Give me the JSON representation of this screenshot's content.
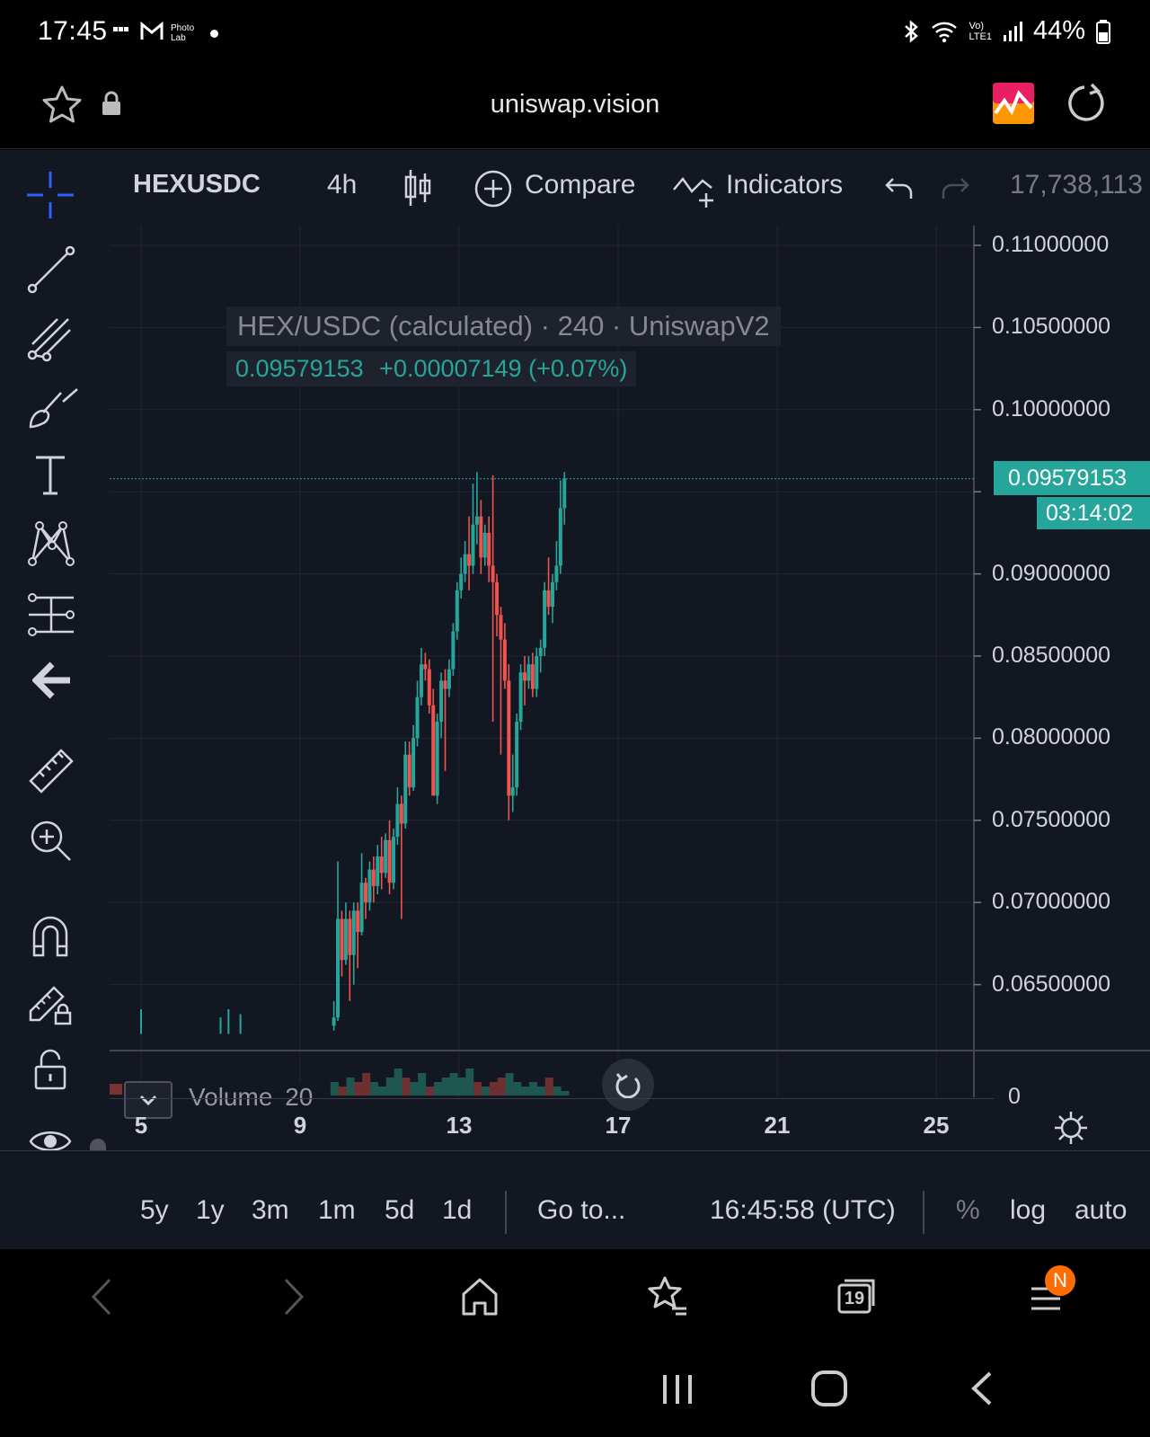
{
  "status_bar": {
    "time": "17:45",
    "battery": "44%",
    "notif_icons": [
      "bbc-news-icon",
      "gmail-icon",
      "photo-lab-icon",
      "dot-icon"
    ],
    "notif_labels": [
      "BBC NEWS",
      "Photo Lab"
    ]
  },
  "browser": {
    "url": "uniswap.vision"
  },
  "toolbar": {
    "symbol": "HEXUSDC",
    "interval": "4h",
    "compare": "Compare",
    "indicators": "Indicators",
    "volume_readout": "17,738,113"
  },
  "legend": {
    "title": "HEX/USDC (calculated) · 240 · UniswapV2",
    "last": "0.09579153",
    "change": "+0.00007149 (+0.07%)"
  },
  "price_axis": {
    "labels": [
      "0.11000000",
      "0.10500000",
      "0.10000000",
      "0.09579153",
      "0.09000000",
      "0.08500000",
      "0.08000000",
      "0.07500000",
      "0.07000000",
      "0.06500000"
    ],
    "current_price": "0.09579153",
    "countdown": "03:14:02",
    "volume_zero": "0"
  },
  "time_axis": {
    "labels": [
      "5",
      "9",
      "13",
      "17",
      "21",
      "25"
    ]
  },
  "volume_pane": {
    "label": "Volume",
    "length": "20"
  },
  "timeframes": [
    "5y",
    "1y",
    "3m",
    "1m",
    "5d",
    "1d"
  ],
  "bottom_bar": {
    "goto": "Go to...",
    "clock": "16:45:58 (UTC)",
    "percent": "%",
    "log": "log",
    "auto": "auto"
  },
  "nav": {
    "tabs_count": "19",
    "badge": "N"
  },
  "colors": {
    "up": "#26a69a",
    "down": "#ef5350",
    "background": "#131722"
  },
  "chart_data": {
    "type": "candlestick",
    "title": "HEX/USDC (calculated) · 240 · UniswapV2",
    "x_ticks": [
      "5",
      "9",
      "13",
      "17",
      "21",
      "25"
    ],
    "ylim": [
      0.062,
      0.112
    ],
    "y_ticks": [
      0.065,
      0.07,
      0.075,
      0.08,
      0.085,
      0.09,
      0.095,
      0.1,
      0.105,
      0.11
    ],
    "last_price": 0.09579153,
    "candles": [
      [
        9.85,
        0.0625,
        0.063,
        0.0622,
        0.064
      ],
      [
        9.95,
        0.063,
        0.069,
        0.0628,
        0.0725
      ],
      [
        10.05,
        0.069,
        0.0665,
        0.0655,
        0.0695
      ],
      [
        10.15,
        0.0665,
        0.069,
        0.0662,
        0.07
      ],
      [
        10.25,
        0.069,
        0.0668,
        0.064,
        0.0695
      ],
      [
        10.35,
        0.0668,
        0.0695,
        0.065,
        0.07
      ],
      [
        10.45,
        0.0695,
        0.0682,
        0.066,
        0.07
      ],
      [
        10.55,
        0.0682,
        0.0712,
        0.068,
        0.073
      ],
      [
        10.65,
        0.0712,
        0.07,
        0.069,
        0.0715
      ],
      [
        10.75,
        0.07,
        0.072,
        0.0695,
        0.0725
      ],
      [
        10.85,
        0.072,
        0.071,
        0.07,
        0.0728
      ],
      [
        10.95,
        0.071,
        0.0728,
        0.0705,
        0.0735
      ],
      [
        11.05,
        0.0728,
        0.0718,
        0.0708,
        0.074
      ],
      [
        11.15,
        0.0718,
        0.0738,
        0.0715,
        0.0742
      ],
      [
        11.25,
        0.0738,
        0.0712,
        0.0705,
        0.075
      ],
      [
        11.35,
        0.0712,
        0.074,
        0.0708,
        0.0745
      ],
      [
        11.45,
        0.074,
        0.076,
        0.0735,
        0.077
      ],
      [
        11.55,
        0.076,
        0.0748,
        0.069,
        0.0765
      ],
      [
        11.65,
        0.0748,
        0.079,
        0.0745,
        0.0798
      ],
      [
        11.75,
        0.079,
        0.077,
        0.0765,
        0.0798
      ],
      [
        11.85,
        0.077,
        0.08,
        0.0768,
        0.0808
      ],
      [
        11.95,
        0.08,
        0.0825,
        0.0795,
        0.0835
      ],
      [
        12.05,
        0.0825,
        0.0845,
        0.082,
        0.0855
      ],
      [
        12.15,
        0.0845,
        0.0842,
        0.0835,
        0.0852
      ],
      [
        12.25,
        0.0842,
        0.082,
        0.0815,
        0.0848
      ],
      [
        12.35,
        0.082,
        0.0765,
        0.0765,
        0.083
      ],
      [
        12.45,
        0.0765,
        0.081,
        0.076,
        0.0815
      ],
      [
        12.55,
        0.081,
        0.0835,
        0.08,
        0.084
      ],
      [
        12.65,
        0.0835,
        0.083,
        0.078,
        0.0842
      ],
      [
        12.75,
        0.083,
        0.0842,
        0.0825,
        0.0848
      ],
      [
        12.85,
        0.0842,
        0.0865,
        0.0838,
        0.087
      ],
      [
        12.95,
        0.0865,
        0.089,
        0.086,
        0.0895
      ],
      [
        13.05,
        0.089,
        0.09,
        0.0885,
        0.091
      ],
      [
        13.15,
        0.09,
        0.0912,
        0.0895,
        0.092
      ],
      [
        13.25,
        0.0912,
        0.0905,
        0.089,
        0.0935
      ],
      [
        13.35,
        0.0905,
        0.093,
        0.09,
        0.0955
      ],
      [
        13.45,
        0.093,
        0.0935,
        0.0918,
        0.0962
      ],
      [
        13.55,
        0.0935,
        0.091,
        0.09,
        0.0945
      ],
      [
        13.65,
        0.091,
        0.0925,
        0.0905,
        0.093
      ],
      [
        13.75,
        0.0925,
        0.0905,
        0.0895,
        0.0935
      ],
      [
        13.85,
        0.0905,
        0.0895,
        0.081,
        0.096
      ],
      [
        13.95,
        0.0895,
        0.0875,
        0.0862,
        0.09
      ],
      [
        14.05,
        0.0875,
        0.086,
        0.079,
        0.088
      ],
      [
        14.15,
        0.086,
        0.0835,
        0.083,
        0.087
      ],
      [
        14.25,
        0.0835,
        0.0765,
        0.075,
        0.0845
      ],
      [
        14.35,
        0.0765,
        0.077,
        0.0755,
        0.079
      ],
      [
        14.45,
        0.077,
        0.081,
        0.0765,
        0.0815
      ],
      [
        14.55,
        0.081,
        0.084,
        0.0805,
        0.0845
      ],
      [
        14.65,
        0.084,
        0.0835,
        0.082,
        0.085
      ],
      [
        14.75,
        0.0835,
        0.0845,
        0.083,
        0.085
      ],
      [
        14.85,
        0.0845,
        0.083,
        0.0825,
        0.0852
      ],
      [
        14.95,
        0.083,
        0.085,
        0.0825,
        0.0855
      ],
      [
        15.05,
        0.085,
        0.0855,
        0.084,
        0.086
      ],
      [
        15.15,
        0.0855,
        0.089,
        0.085,
        0.0895
      ],
      [
        15.25,
        0.089,
        0.088,
        0.0875,
        0.091
      ],
      [
        15.35,
        0.088,
        0.0895,
        0.087,
        0.09
      ],
      [
        15.45,
        0.0895,
        0.0905,
        0.089,
        0.092
      ],
      [
        15.55,
        0.0905,
        0.094,
        0.09,
        0.0957
      ],
      [
        15.65,
        0.094,
        0.0958,
        0.093,
        0.0962
      ]
    ],
    "volume_bars": [
      [
        9.9,
        3,
        "up"
      ],
      [
        10.1,
        2,
        "down"
      ],
      [
        10.3,
        4,
        "up"
      ],
      [
        10.5,
        3,
        "down"
      ],
      [
        10.7,
        5,
        "down"
      ],
      [
        10.9,
        3,
        "up"
      ],
      [
        11.1,
        2,
        "up"
      ],
      [
        11.3,
        4,
        "up"
      ],
      [
        11.5,
        6,
        "up"
      ],
      [
        11.7,
        4,
        "down"
      ],
      [
        11.9,
        3,
        "up"
      ],
      [
        12.1,
        5,
        "up"
      ],
      [
        12.3,
        2,
        "down"
      ],
      [
        12.5,
        3,
        "up"
      ],
      [
        12.7,
        4,
        "up"
      ],
      [
        12.9,
        5,
        "up"
      ],
      [
        13.1,
        4,
        "up"
      ],
      [
        13.3,
        6,
        "up"
      ],
      [
        13.5,
        3,
        "down"
      ],
      [
        13.7,
        2,
        "up"
      ],
      [
        13.9,
        3,
        "down"
      ],
      [
        14.1,
        4,
        "down"
      ],
      [
        14.3,
        5,
        "up"
      ],
      [
        14.5,
        3,
        "up"
      ],
      [
        14.7,
        2,
        "up"
      ],
      [
        14.9,
        3,
        "up"
      ],
      [
        15.1,
        2,
        "up"
      ],
      [
        15.3,
        4,
        "down"
      ],
      [
        15.5,
        2,
        "up"
      ],
      [
        15.7,
        1,
        "up"
      ]
    ]
  }
}
